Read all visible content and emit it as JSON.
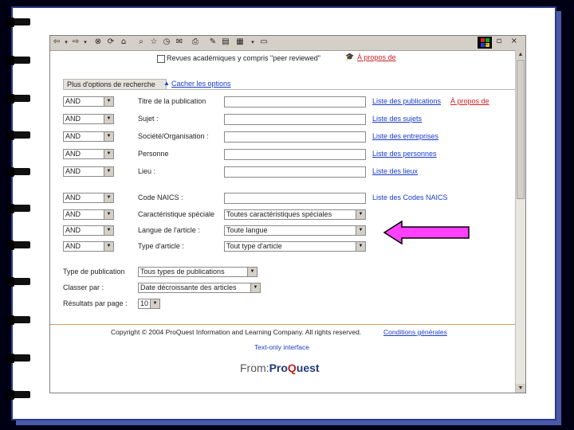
{
  "browser": {
    "toolbar_icons": [
      "back-icon",
      "forward-icon",
      "stop-icon",
      "refresh-icon",
      "home-icon",
      "search-icon",
      "favorites-icon",
      "history-icon",
      "mail-icon",
      "print-icon",
      "edit-icon",
      "discuss-icon"
    ]
  },
  "top": {
    "checkbox_label": "Revues académiques y compris \"peer reviewed\"",
    "about_link": "À propos de"
  },
  "options": {
    "tab_label": "Plus d'options de recherche",
    "hide_link": "Cacher les options"
  },
  "fields": [
    {
      "op": "AND",
      "label": "Titre de la publication",
      "list_link": "Liste des publications",
      "extra_link": "À propos de"
    },
    {
      "op": "AND",
      "label": "Sujet :",
      "list_link": "Liste des sujets"
    },
    {
      "op": "AND",
      "label": "Société/Organisation :",
      "list_link": "Liste des entreprises"
    },
    {
      "op": "AND",
      "label": "Personne",
      "list_link": "Liste des personnes"
    },
    {
      "op": "AND",
      "label": "Lieu :",
      "list_link": "Liste des lieux"
    }
  ],
  "fields2": [
    {
      "op": "AND",
      "label": "Code NAICS :",
      "list_link": "Liste des Codes NAICS"
    },
    {
      "op": "AND",
      "label": "Caractéristique spéciale",
      "select": "Toutes caractéristiques spéciales"
    },
    {
      "op": "AND",
      "label": "Langue de l'article :",
      "select": "Toute langue"
    },
    {
      "op": "AND",
      "label": "Type d'article :",
      "select": "Tout type d'article"
    }
  ],
  "bottom_fields": [
    {
      "label": "Type de publication",
      "select": "Tous types de publications"
    },
    {
      "label": "Classer par :",
      "select": "Date décroissante des articles"
    },
    {
      "label": "Résultats par page :",
      "select": "10"
    }
  ],
  "footer": {
    "copyright": "Copyright © 2004 ProQuest Information and Learning Company. All rights reserved.",
    "terms_link": "Conditions générales",
    "text_only_link": "Text-only interface",
    "logo_from": "From:",
    "logo_pro": "Pro",
    "logo_q": "Q",
    "logo_uest": "uest"
  },
  "colors": {
    "link": "#1a3cc8",
    "accent_red": "#cc2020",
    "arrow": "#ff40ff",
    "page_border": "#2b3a8c"
  }
}
